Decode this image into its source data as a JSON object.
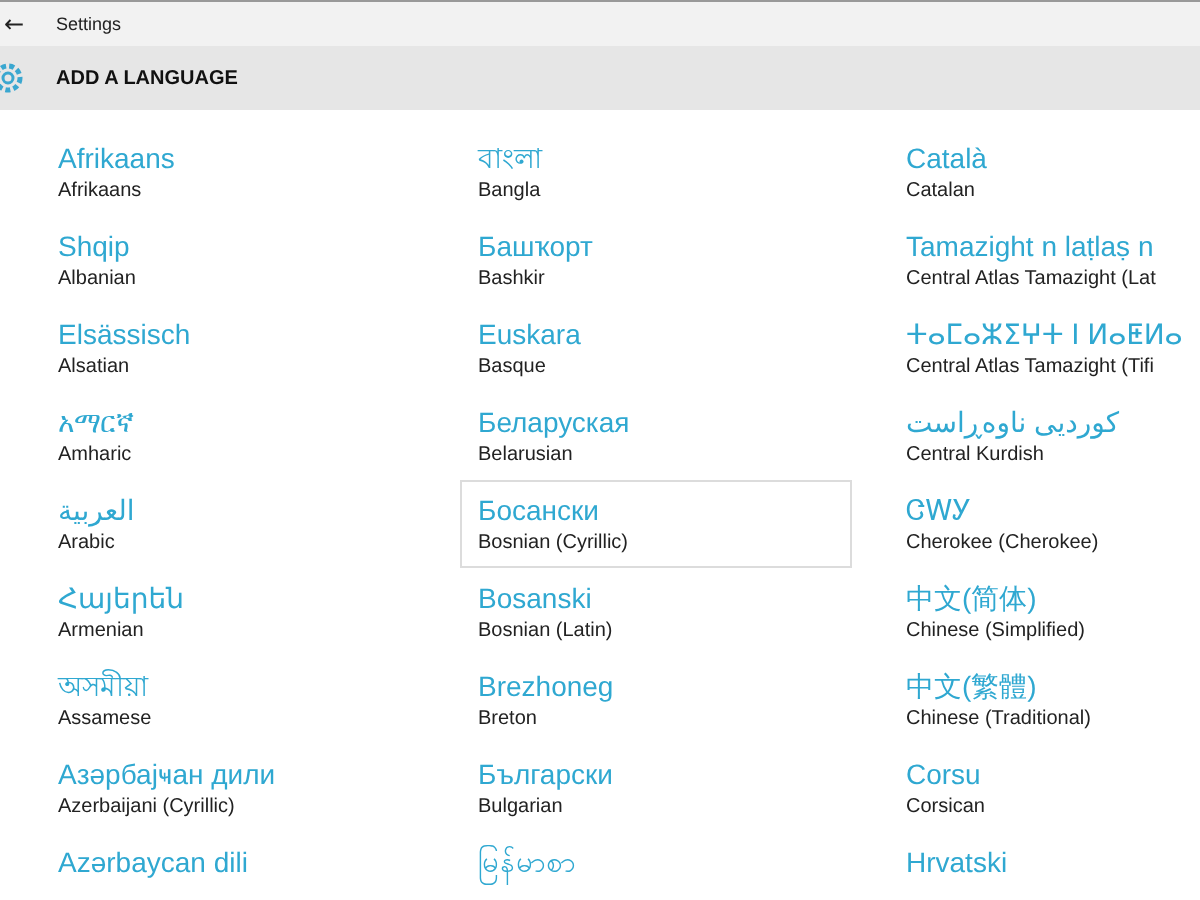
{
  "window": {
    "title": "Settings",
    "back": "←"
  },
  "header": {
    "title": "ADD A LANGUAGE"
  },
  "columns": [
    [
      {
        "native": "Afrikaans",
        "english": "Afrikaans",
        "selected": false
      },
      {
        "native": "Shqip",
        "english": "Albanian",
        "selected": false
      },
      {
        "native": "Elsässisch",
        "english": "Alsatian",
        "selected": false
      },
      {
        "native": "አማርኛ",
        "english": "Amharic",
        "selected": false
      },
      {
        "native": "العربية",
        "english": "Arabic",
        "selected": false
      },
      {
        "native": "Հայերեն",
        "english": "Armenian",
        "selected": false
      },
      {
        "native": "অসমীয়া",
        "english": "Assamese",
        "selected": false
      },
      {
        "native": "Азәрбајҹан дили",
        "english": "Azerbaijani (Cyrillic)",
        "selected": false
      },
      {
        "native": "Azərbaycan dili",
        "selected": false
      }
    ],
    [
      {
        "native": "বাংলা",
        "english": "Bangla",
        "selected": false
      },
      {
        "native": "Башҡорт",
        "english": "Bashkir",
        "selected": false
      },
      {
        "native": "Euskara",
        "english": "Basque",
        "selected": false
      },
      {
        "native": "Беларуская",
        "english": "Belarusian",
        "selected": false
      },
      {
        "native": "Босански",
        "english": "Bosnian (Cyrillic)",
        "selected": true
      },
      {
        "native": "Bosanski",
        "english": "Bosnian (Latin)",
        "selected": false
      },
      {
        "native": "Brezhoneg",
        "english": "Breton",
        "selected": false
      },
      {
        "native": "Български",
        "english": "Bulgarian",
        "selected": false
      },
      {
        "native": "မြန်မာစာ",
        "selected": false
      }
    ],
    [
      {
        "native": "Català",
        "english": "Catalan",
        "selected": false
      },
      {
        "native": "Tamazight n laṭlaṣ n",
        "english": "Central Atlas Tamazight (Lat",
        "selected": false
      },
      {
        "native": "ⵜⴰⵎⴰⵣⵉⵖⵜ ⵏ ⵍⴰⵟⵍⴰ",
        "english": "Central Atlas Tamazight (Tifi",
        "selected": false
      },
      {
        "native": "کوردیی ناوەڕاست",
        "english": "Central Kurdish",
        "selected": false
      },
      {
        "native": "ᏣᎳᎩ",
        "english": "Cherokee (Cherokee)",
        "selected": false
      },
      {
        "native": "中文(简体)",
        "english": "Chinese (Simplified)",
        "selected": false
      },
      {
        "native": "中文(繁體)",
        "english": "Chinese (Traditional)",
        "selected": false
      },
      {
        "native": "Corsu",
        "english": "Corsican",
        "selected": false
      },
      {
        "native": "Hrvatski",
        "selected": false
      }
    ]
  ]
}
